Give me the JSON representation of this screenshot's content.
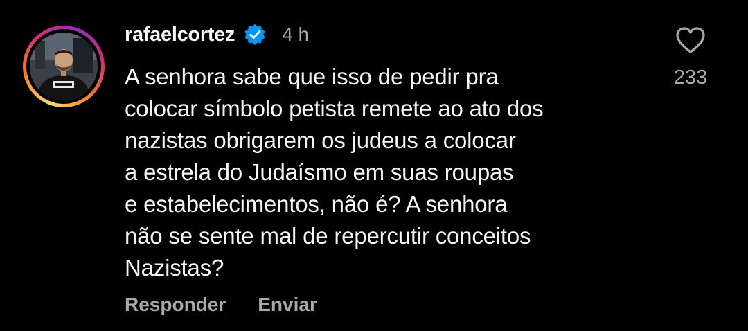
{
  "comment": {
    "username": "rafaelcortez",
    "verified": true,
    "time": "4 h",
    "lines": [
      "A senhora sabe que isso de pedir pra",
      "colocar símbolo petista remete ao ato dos",
      "nazistas obrigarem os judeus a colocar",
      "a estrela do Judaísmo em suas roupas",
      "e estabelecimentos, não é? A senhora",
      "não se sente mal de repercutir conceitos",
      "Nazistas?"
    ],
    "like_count": "233",
    "reply_label": "Responder",
    "send_label": "Enviar"
  },
  "colors": {
    "background": "#000000",
    "text": "#f5f5f5",
    "muted": "#a8a8a8",
    "verified_blue": "#0095f6"
  },
  "icons": {
    "verified": "verified-badge-icon",
    "like": "heart-outline-icon"
  }
}
